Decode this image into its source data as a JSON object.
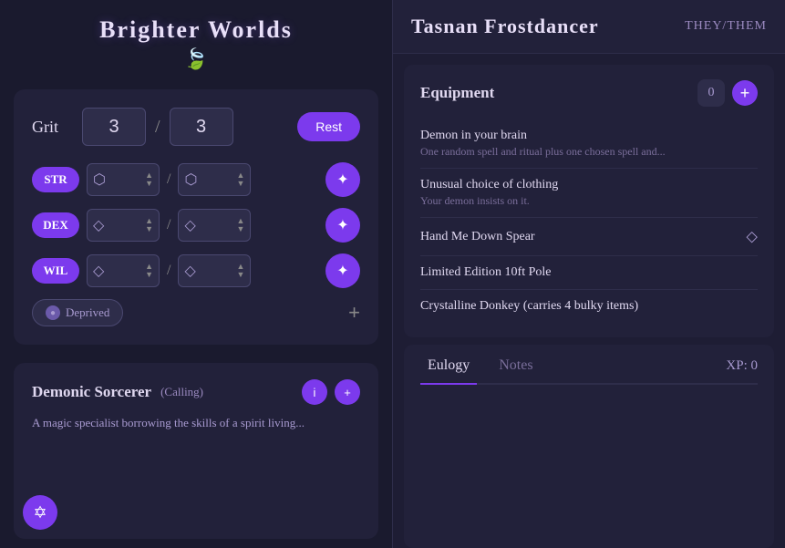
{
  "app": {
    "title": "Brighter Worlds",
    "logo_leaf": "🍃"
  },
  "left": {
    "grit": {
      "label": "Grit",
      "current": "3",
      "max": "3",
      "rest_btn": "Rest"
    },
    "stats": [
      {
        "id": "str",
        "label": "STR",
        "die1_icon": "⬡",
        "die2_icon": "⬡",
        "action_icon": "✦"
      },
      {
        "id": "dex",
        "label": "DEX",
        "die1_icon": "◇",
        "die2_icon": "◇",
        "action_icon": "✦"
      },
      {
        "id": "wil",
        "label": "WIL",
        "die1_icon": "◇",
        "die2_icon": "◇",
        "action_icon": "✦"
      }
    ],
    "deprived": {
      "label": "Deprived"
    },
    "calling": {
      "title": "Demonic Sorcerer",
      "label": "(Calling)",
      "description": "A magic specialist borrowing the skills of a spirit living..."
    }
  },
  "right": {
    "character": {
      "name": "Tasnan Frostdancer",
      "pronouns": "THEY/THEM"
    },
    "equipment": {
      "title": "Equipment",
      "shield_value": "0",
      "items": [
        {
          "name": "Demon in your brain",
          "desc": "One random spell and ritual plus one chosen spell and...",
          "has_diamond": false
        },
        {
          "name": "Unusual choice of clothing",
          "desc": "Your demon insists on it.",
          "has_diamond": false
        },
        {
          "name": "Hand Me Down Spear",
          "desc": "",
          "has_diamond": true
        },
        {
          "name": "Limited Edition 10ft Pole",
          "desc": "",
          "has_diamond": false
        },
        {
          "name": "Crystalline Donkey (carries 4 bulky items)",
          "desc": "",
          "has_diamond": false
        }
      ]
    },
    "tabs": [
      {
        "id": "eulogy",
        "label": "Eulogy",
        "active": true
      },
      {
        "id": "notes",
        "label": "Notes",
        "active": false
      }
    ],
    "xp": {
      "label": "XP:",
      "value": "0"
    }
  }
}
